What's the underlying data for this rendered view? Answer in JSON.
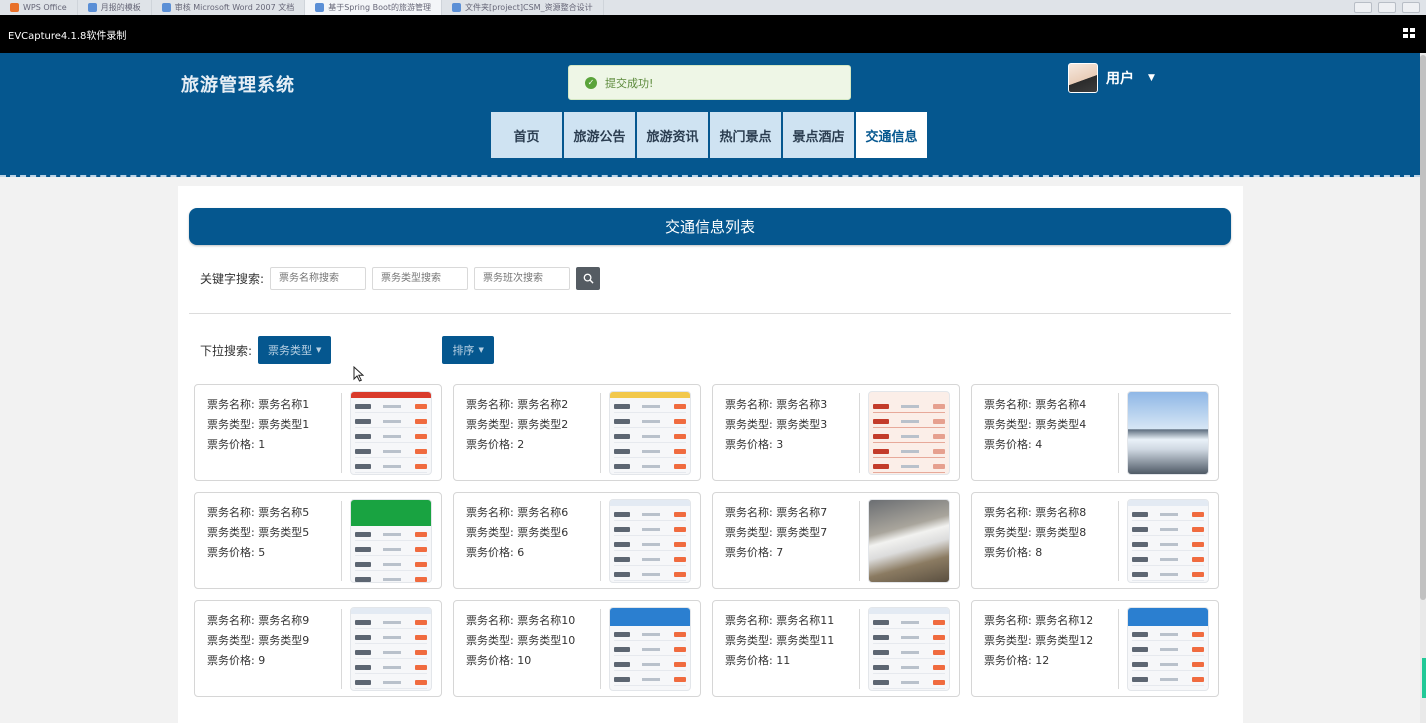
{
  "os_tabs": [
    "WPS Office",
    "月报的模板",
    "审核 Microsoft Word 2007 文档",
    "基于Spring Boot的旅游管理",
    "文件夹[project]CSM_资源整合设计"
  ],
  "recorder": {
    "title": "EVCapture4.1.8软件录制"
  },
  "header": {
    "site_title": "旅游管理系统",
    "toast": "提交成功!",
    "user": "用户",
    "nav": [
      {
        "label": "首页",
        "active": false
      },
      {
        "label": "旅游公告",
        "active": false
      },
      {
        "label": "旅游资讯",
        "active": false
      },
      {
        "label": "热门景点",
        "active": false
      },
      {
        "label": "景点酒店",
        "active": false
      },
      {
        "label": "交通信息",
        "active": true
      }
    ]
  },
  "main": {
    "list_title": "交通信息列表",
    "search_label": "关键字搜索:",
    "placeholders": {
      "name": "票务名称搜索",
      "type": "票务类型搜索",
      "shift": "票务班次搜索"
    },
    "dropdown_label": "下拉搜索:",
    "type_dropdown": "票务类型",
    "sort_dropdown": "排序"
  },
  "card_labels": {
    "name": "票务名称: ",
    "type": "票务类型: ",
    "price": "票务价格: "
  },
  "tickets": [
    {
      "name": "票务名称1",
      "type": "票务类型1",
      "price": "1",
      "thumb": "red-header"
    },
    {
      "name": "票务名称2",
      "type": "票务类型2",
      "price": "2",
      "thumb": "yellow-header"
    },
    {
      "name": "票务名称3",
      "type": "票务类型3",
      "price": "3",
      "thumb": "red-doc"
    },
    {
      "name": "票务名称4",
      "type": "票务类型4",
      "price": "4",
      "thumb": "photo-train"
    },
    {
      "name": "票务名称5",
      "type": "票务类型5",
      "price": "5",
      "thumb": "green"
    },
    {
      "name": "票务名称6",
      "type": "票务类型6",
      "price": "6",
      "thumb": "list"
    },
    {
      "name": "票务名称7",
      "type": "票务类型7",
      "price": "7",
      "thumb": "photo-train2"
    },
    {
      "name": "票务名称8",
      "type": "票务类型8",
      "price": "8",
      "thumb": "list"
    },
    {
      "name": "票务名称9",
      "type": "票务类型9",
      "price": "9",
      "thumb": "list"
    },
    {
      "name": "票务名称10",
      "type": "票务类型10",
      "price": "10",
      "thumb": "blue"
    },
    {
      "name": "票务名称11",
      "type": "票务类型11",
      "price": "11",
      "thumb": "list"
    },
    {
      "name": "票务名称12",
      "type": "票务类型12",
      "price": "12",
      "thumb": "blue"
    }
  ]
}
